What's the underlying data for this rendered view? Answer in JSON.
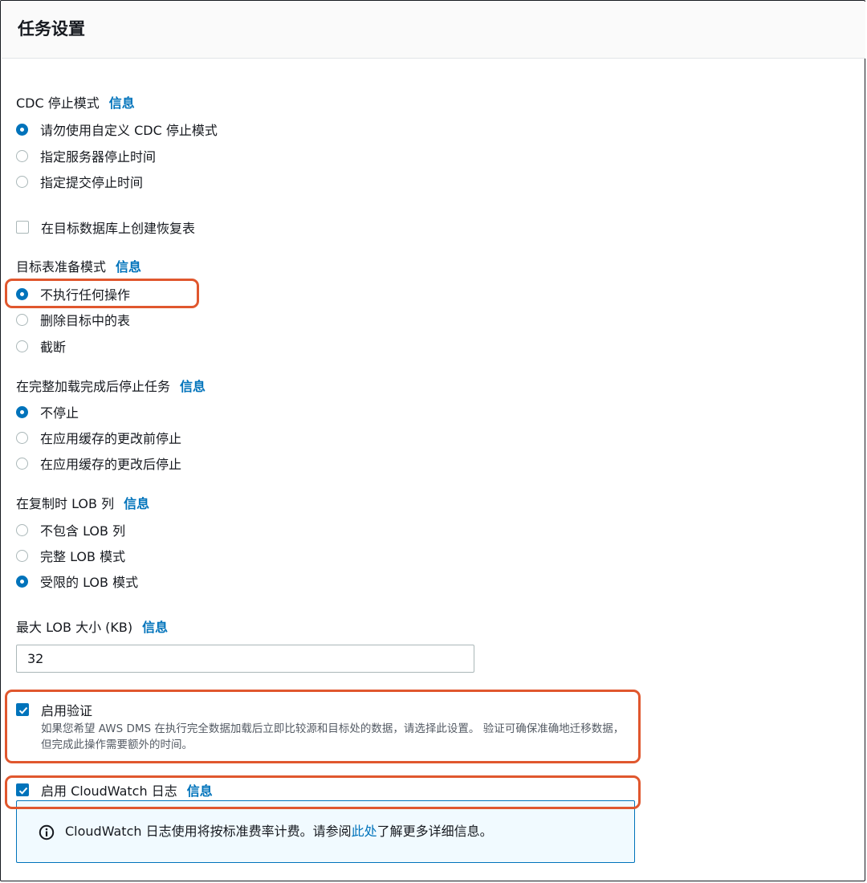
{
  "header": {
    "title": "任务设置"
  },
  "info_link_label": "信息",
  "cdc_stop_mode": {
    "label": "CDC 停止模式",
    "options": [
      {
        "label": "请勿使用自定义 CDC 停止模式",
        "checked": true
      },
      {
        "label": "指定服务器停止时间",
        "checked": false
      },
      {
        "label": "指定提交停止时间",
        "checked": false
      }
    ]
  },
  "recovery_table": {
    "label": "在目标数据库上创建恢复表",
    "checked": false
  },
  "target_prep_mode": {
    "label": "目标表准备模式",
    "options": [
      {
        "label": "不执行任何操作",
        "checked": true
      },
      {
        "label": "删除目标中的表",
        "checked": false
      },
      {
        "label": "截断",
        "checked": false
      }
    ]
  },
  "stop_after_full_load": {
    "label": "在完整加载完成后停止任务",
    "options": [
      {
        "label": "不停止",
        "checked": true
      },
      {
        "label": "在应用缓存的更改前停止",
        "checked": false
      },
      {
        "label": "在应用缓存的更改后停止",
        "checked": false
      }
    ]
  },
  "lob_columns": {
    "label": "在复制时 LOB 列",
    "options": [
      {
        "label": "不包含 LOB 列",
        "checked": false
      },
      {
        "label": "完整 LOB 模式",
        "checked": false
      },
      {
        "label": "受限的 LOB 模式",
        "checked": true
      }
    ]
  },
  "max_lob_size": {
    "label": "最大 LOB 大小 (KB)",
    "value": "32"
  },
  "enable_validation": {
    "label": "启用验证",
    "checked": true,
    "description": "如果您希望 AWS DMS 在执行完全数据加载后立即比较源和目标处的数据，请选择此设置。 验证可确保准确地迁移数据，但完成此操作需要额外的时间。"
  },
  "enable_cloudwatch": {
    "label": "启用 CloudWatch 日志",
    "checked": true
  },
  "cloudwatch_alert": {
    "text_before": "CloudWatch 日志使用将按标准费率计费。请参阅",
    "link": "此处",
    "text_after": "了解更多详细信息。",
    "icon": "info-circle-icon"
  },
  "colors": {
    "accent": "#0073bb",
    "highlight": "#e0572e",
    "text": "#16191f",
    "secondary_text": "#545b64",
    "alert_bg": "#f1faff"
  }
}
